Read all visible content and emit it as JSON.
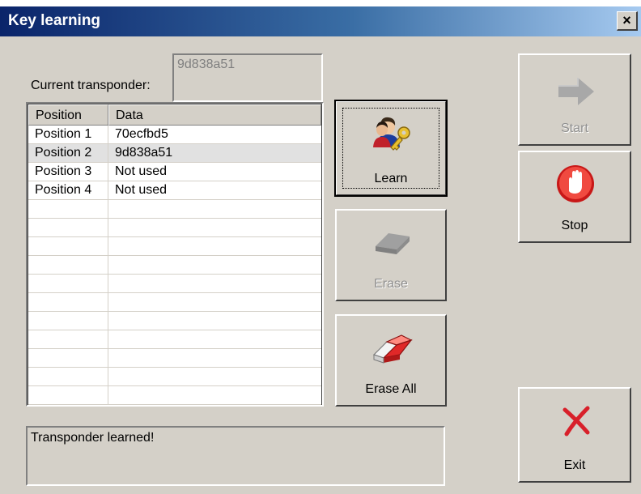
{
  "window": {
    "title": "Key learning",
    "close_label": "×"
  },
  "transponder": {
    "label": "Current transponder:",
    "value": "9d838a51"
  },
  "table": {
    "headers": [
      "Position",
      "Data"
    ],
    "rows": [
      {
        "position": "Position 1",
        "data": "70ecfbd5"
      },
      {
        "position": "Position 2",
        "data": "9d838a51"
      },
      {
        "position": "Position 3",
        "data": "Not used"
      },
      {
        "position": "Position 4",
        "data": "Not used"
      }
    ],
    "selected_row": 2
  },
  "buttons": {
    "learn": "Learn",
    "erase": "Erase",
    "erase_all": "Erase All",
    "start": "Start",
    "stop": "Stop",
    "exit": "Exit"
  },
  "icons": {
    "learn": "person-with-key-icon",
    "erase": "eraser-block-icon",
    "erase_all": "red-eraser-icon",
    "start": "right-arrow-icon",
    "stop": "stop-hand-icon",
    "exit": "red-x-icon"
  },
  "status": {
    "message": "Transponder learned!"
  },
  "colors": {
    "titlebar_start": "#0a246a",
    "titlebar_end": "#a6caf0",
    "dialog_bg": "#d4d0c8",
    "stop_red": "#e0302a",
    "exit_red": "#d8202a"
  }
}
